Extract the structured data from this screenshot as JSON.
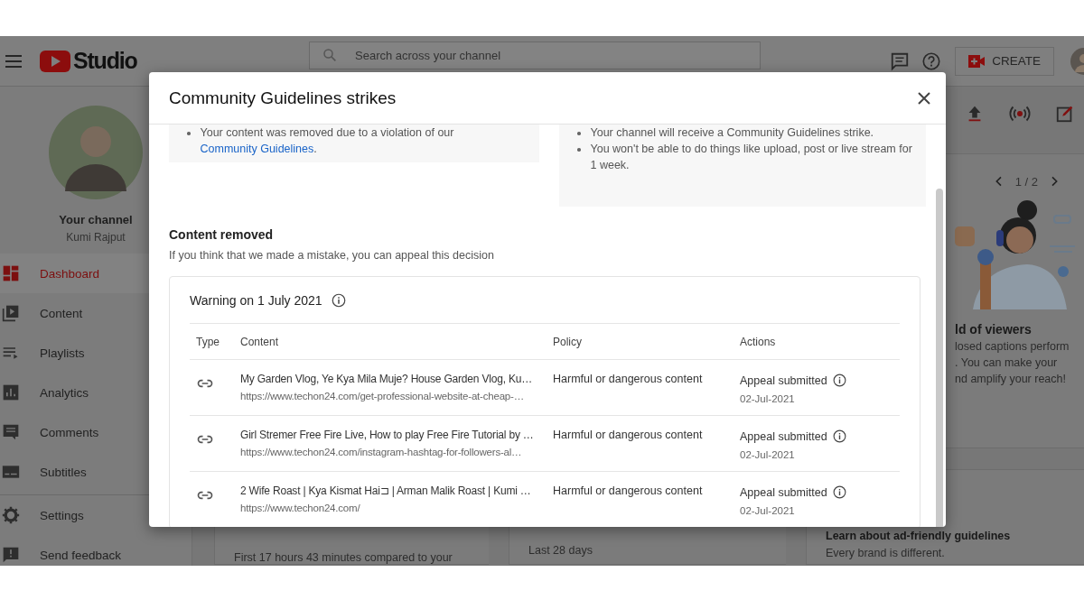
{
  "header": {
    "logo_text": "Studio",
    "search": {
      "placeholder": "Search across your channel"
    },
    "create_button": "CREATE"
  },
  "sidebar": {
    "channel_label": "Your channel",
    "channel_name": "Kumi Rajput",
    "items": [
      {
        "label": "Dashboard",
        "selected": true
      },
      {
        "label": "Content",
        "selected": false
      },
      {
        "label": "Playlists",
        "selected": false
      },
      {
        "label": "Analytics",
        "selected": false
      },
      {
        "label": "Comments",
        "selected": false
      },
      {
        "label": "Subtitles",
        "selected": false
      }
    ],
    "footer_items": [
      "Settings",
      "Send feedback"
    ]
  },
  "dashboard": {
    "pager": "1 / 2",
    "tip_title": "ld of viewers",
    "tip_lines": [
      "losed captions perform",
      ". You can make your",
      "nd amplify your reach!"
    ],
    "bottom_cards": [
      {
        "text": "First 17 hours 43 minutes compared to your"
      },
      {
        "text": "Last 28 days"
      },
      {
        "title": "Learn about ad-friendly guidelines",
        "text": "Every brand is different."
      }
    ]
  },
  "modal": {
    "title": "Community Guidelines strikes",
    "notice_left": {
      "text": "Your content was removed due to a violation of our",
      "link": "Community Guidelines",
      "after": "."
    },
    "notice_right": [
      "Your channel will receive a Community Guidelines strike.",
      "You won't be able to do things like upload, post or live stream for 1 week."
    ],
    "section_title": "Content removed",
    "section_subtitle": "If you think that we made a mistake, you can appeal this decision",
    "warning": {
      "title": "Warning on 1 July 2021",
      "columns": [
        "Type",
        "Content",
        "Policy",
        "Actions"
      ],
      "rows": [
        {
          "title": "My Garden Vlog, Ye Kya Mila Muje? House Garden Vlog, Ku…",
          "url": "https://www.techon24.com/get-professional-website-at-cheap-…",
          "policy": "Harmful or dangerous content",
          "action": "Appeal submitted",
          "date": "02-Jul-2021"
        },
        {
          "title": "Girl Stremer Free Fire Live, How to play Free Fire Tutorial by …",
          "url": "https://www.techon24.com/instagram-hashtag-for-followers-al…",
          "policy": "Harmful or dangerous content",
          "action": "Appeal submitted",
          "date": "02-Jul-2021"
        },
        {
          "title": "2 Wife Roast | Kya Kismat Hai⊐ | Arman Malik Roast | Kumi …",
          "url": "https://www.techon24.com/",
          "policy": "Harmful or dangerous content",
          "action": "Appeal submitted",
          "date": "02-Jul-2021"
        }
      ]
    }
  }
}
